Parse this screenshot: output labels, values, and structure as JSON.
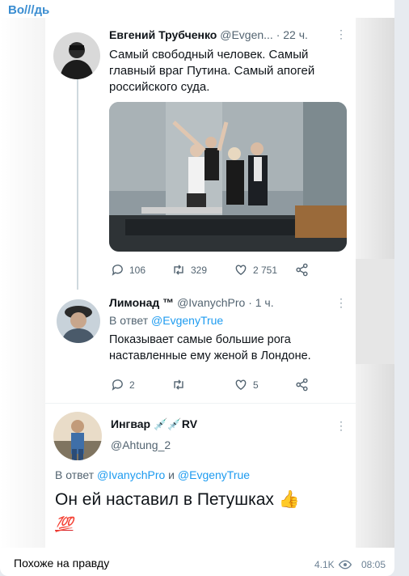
{
  "channel": {
    "title": "Во///дь"
  },
  "tweets": [
    {
      "author": "Евгений Трубченко",
      "handle": "@Evgen...",
      "time": "· 22 ч.",
      "text": "Самый свободный человек. Самый главный враг Путина. Самый апогей российского суда.",
      "stats": {
        "replies": "106",
        "retweets": "329",
        "likes": "2 751"
      }
    },
    {
      "author": "Лимонад ™",
      "handle": "@IvanychPro · 1 ч.",
      "reply_prefix": "В ответ",
      "reply_to": "@EvgenyTrue",
      "text": "Показывает самые большие рога наставленные ему женой в Лондоне.",
      "stats": {
        "replies": "2",
        "retweets": "",
        "likes": "5"
      }
    },
    {
      "author": "Ингвар 💉💉RV",
      "handle": "@Ahtung_2",
      "reply_prefix": "В ответ",
      "reply_to_1": "@IvanychPro",
      "reply_joiner": "и",
      "reply_to_2": "@EvgenyTrue",
      "text": "Он ей наставил в Петушках 👍",
      "emoji_badge": "💯"
    }
  ],
  "message": {
    "caption": "Похоже на правду",
    "views": "4.1K",
    "time": "08:05"
  },
  "colors": {
    "channel": "#3a8dd1",
    "twitter_link": "#1d9bf0",
    "meta": "#6d8295"
  },
  "icons": [
    "reply-icon",
    "retweet-icon",
    "like-icon",
    "share-icon",
    "eye-icon",
    "more-icon"
  ]
}
